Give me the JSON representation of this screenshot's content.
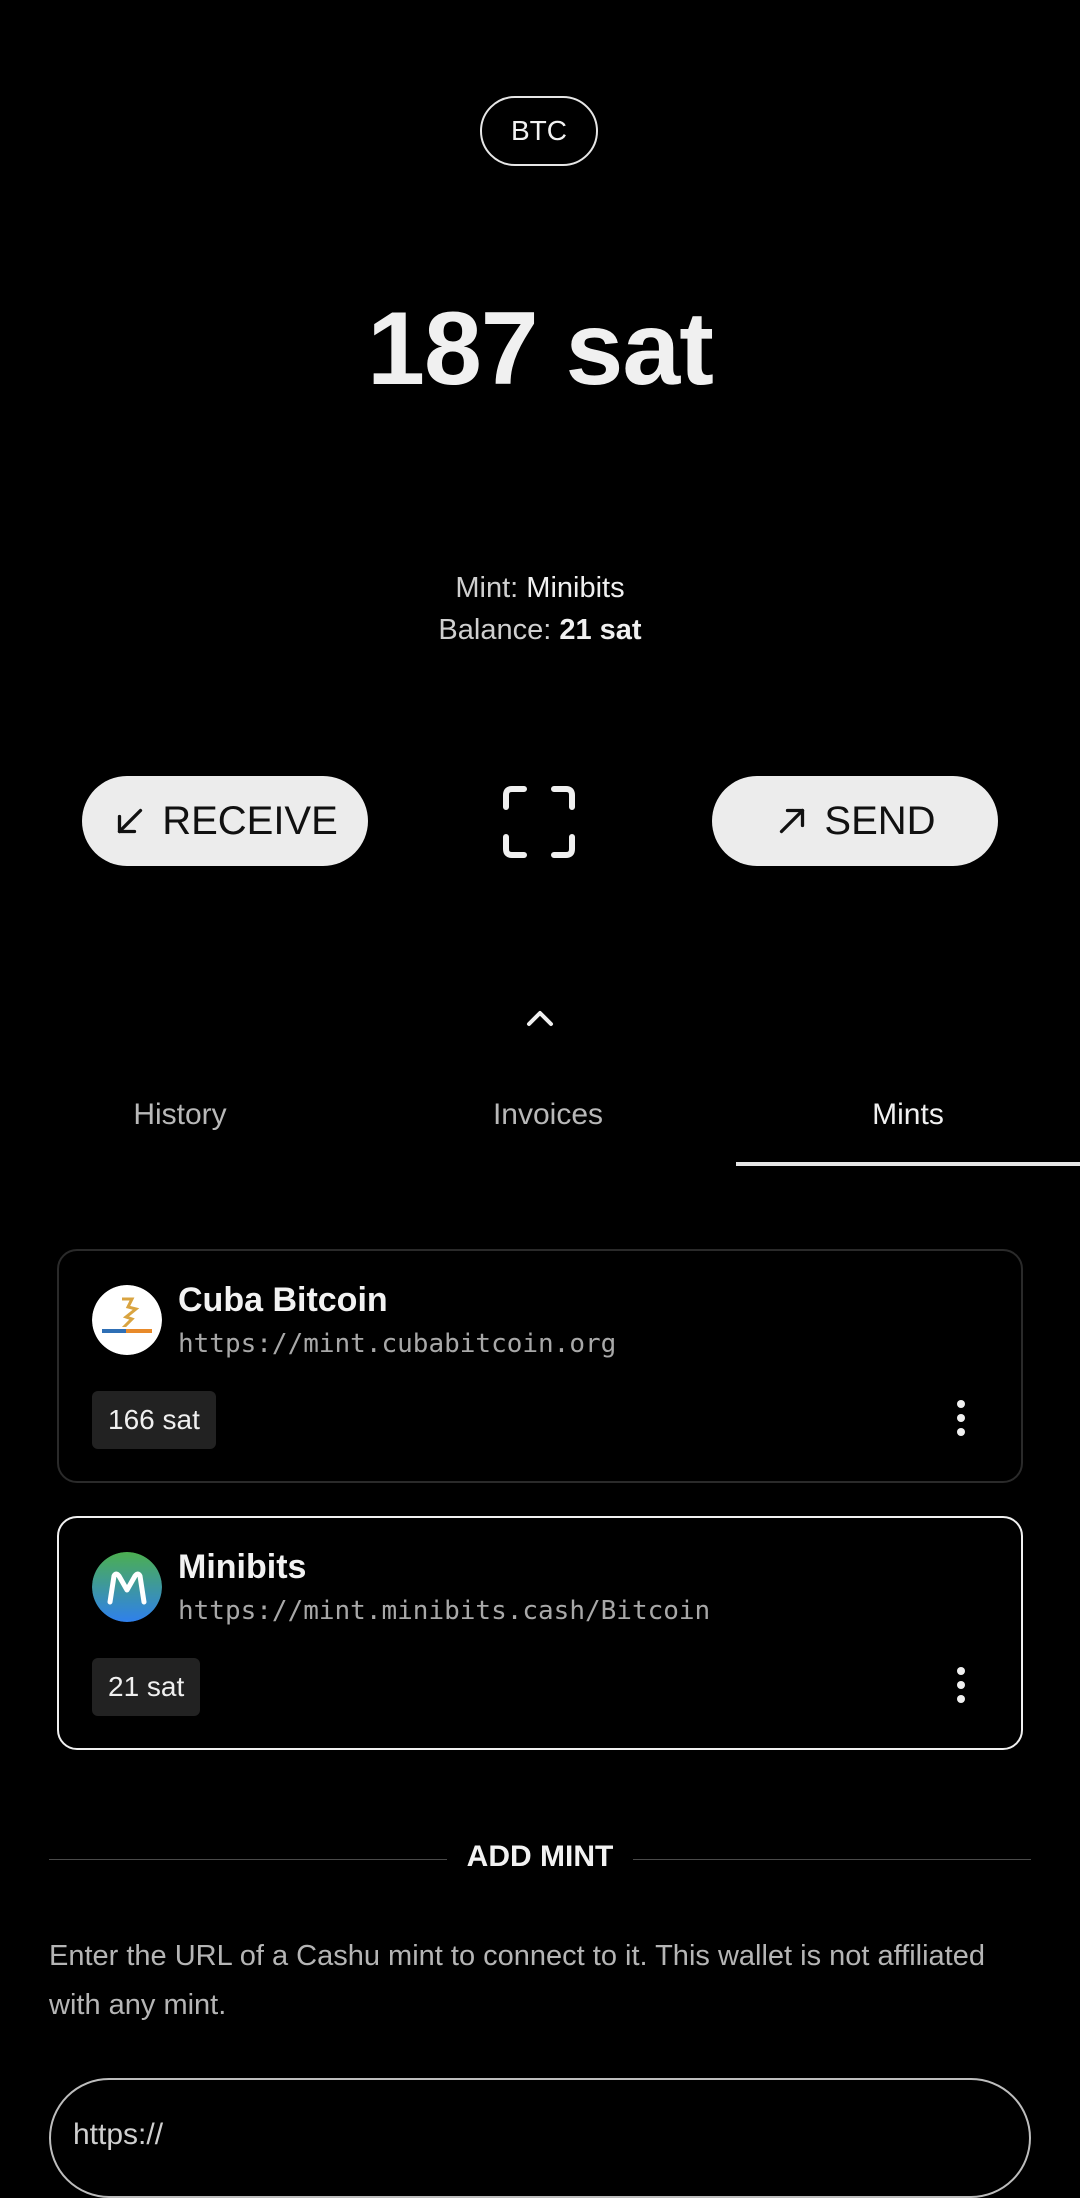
{
  "unit": "BTC",
  "balance": "187 sat",
  "active_mint": {
    "mint_label": "Mint:",
    "mint_name": "Minibits",
    "balance_label": "Balance:",
    "balance_value": "21 sat"
  },
  "actions": {
    "receive": "RECEIVE",
    "send": "SEND",
    "receive_icon": "arrow-down-left-icon",
    "send_icon": "arrow-up-right-icon",
    "scan_icon": "scan-frame-icon"
  },
  "tabs": [
    {
      "label": "History"
    },
    {
      "label": "Invoices"
    },
    {
      "label": "Mints",
      "active": true
    }
  ],
  "mints": [
    {
      "name": "Cuba Bitcoin",
      "url": "https://mint.cubabitcoin.org",
      "balance": "166 sat",
      "selected": false
    },
    {
      "name": "Minibits",
      "url": "https://mint.minibits.cash/Bitcoin",
      "balance": "21 sat",
      "selected": true
    }
  ],
  "add_mint": {
    "title": "ADD MINT",
    "help": "Enter the URL of a Cashu mint to connect to it. This wallet is not affiliated with any mint.",
    "placeholder": "https://"
  },
  "colors": {
    "background": "#000000",
    "button_bg": "#ececec",
    "minibits_logo_top": "#4caf50",
    "minibits_logo_bottom": "#2f80ed"
  }
}
